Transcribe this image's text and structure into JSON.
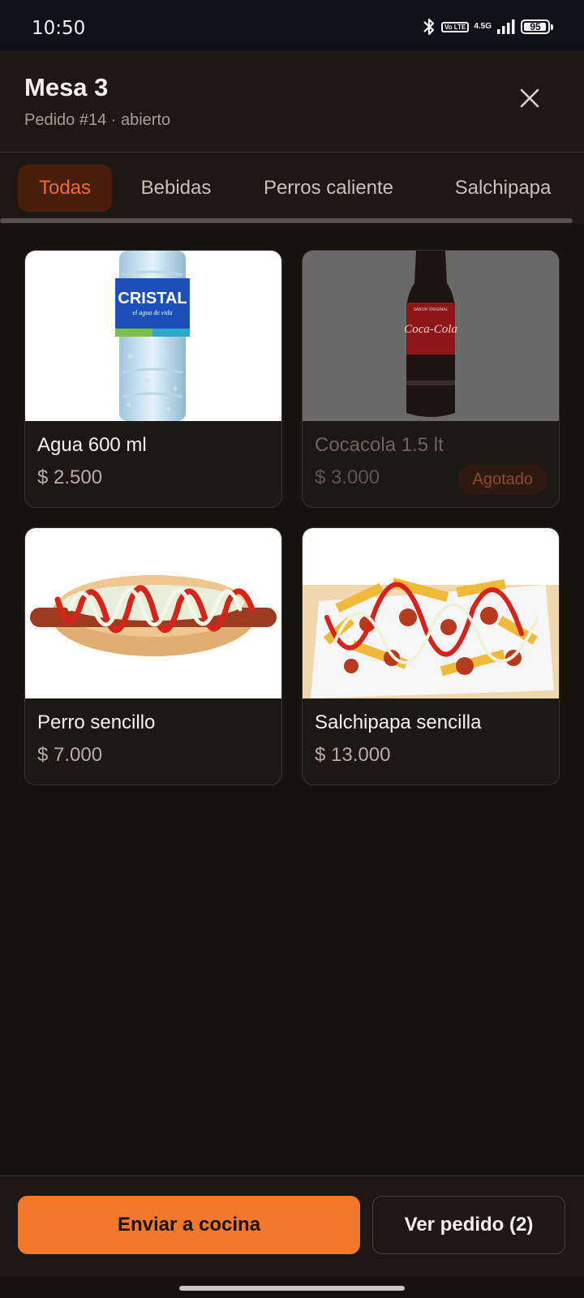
{
  "status_bar": {
    "time": "10:50",
    "volte_label": "Vo LTE",
    "network_label": "4.5G",
    "battery_level": "95",
    "icons": [
      "bluetooth-icon",
      "volte-icon",
      "signal-icon",
      "battery-icon"
    ]
  },
  "header": {
    "title": "Mesa 3",
    "subtitle": "Pedido #14 · abierto",
    "close_icon": "close-icon"
  },
  "tabs": [
    {
      "label": "Todas",
      "active": true
    },
    {
      "label": "Bebidas",
      "active": false
    },
    {
      "label": "Perros caliente",
      "active": false
    },
    {
      "label": "Salchipapa",
      "active": false
    }
  ],
  "products": [
    {
      "name": "Agua 600 ml",
      "price": "$ 2.500",
      "available": true
    },
    {
      "name": "Cocacola 1.5 lt",
      "price": "$ 3.000",
      "available": false,
      "badge": "Agotado"
    },
    {
      "name": "Perro sencillo",
      "price": "$ 7.000",
      "available": true
    },
    {
      "name": "Salchipapa sencilla",
      "price": "$ 13.000",
      "available": true
    }
  ],
  "product_image_text": {
    "water_brand": "CRISTAL",
    "water_tagline": "el agua de vida",
    "cola_brand": "Coca-Cola",
    "cola_top": "SABOR ORIGINAL"
  },
  "actions": {
    "send_to_kitchen": "Enviar a cocina",
    "view_order": "Ver pedido (2)"
  },
  "colors": {
    "accent": "#f2782c",
    "active_tab_bg": "#4a1e0f",
    "active_tab_text": "#ef6a2c",
    "background": "#16120e",
    "surface": "#1d1813"
  }
}
